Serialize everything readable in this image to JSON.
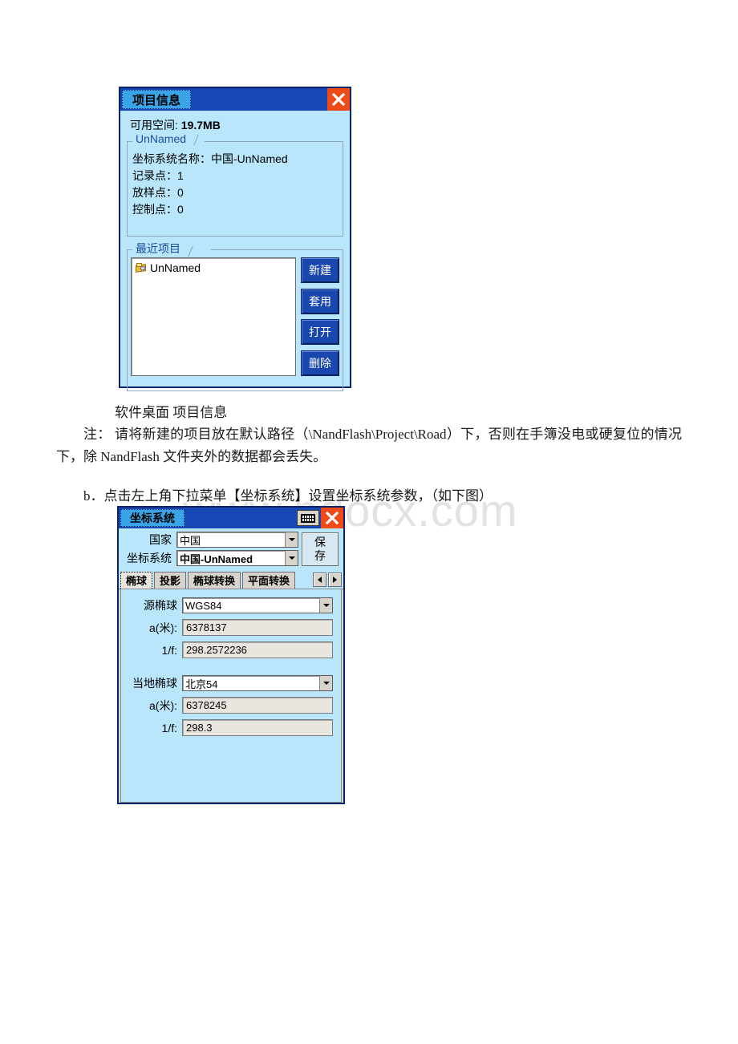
{
  "watermark": "www.bdocx.com",
  "project_dialog": {
    "title": "项目信息",
    "close_icon": "close-icon",
    "free_space_label": "可用空间:",
    "free_space_value": "19.7MB",
    "project_group": {
      "caption": "UnNamed",
      "lines": [
        "坐标系统名称：中国-UnNamed",
        "记录点：1",
        "放样点：0",
        "控制点：0"
      ]
    },
    "recent_group": {
      "caption": "最近项目",
      "items": [
        {
          "icon": "project-file-icon",
          "label": "UnNamed"
        }
      ],
      "buttons": [
        {
          "label": "新建"
        },
        {
          "label": "套用"
        },
        {
          "label": "打开"
        },
        {
          "label": "删除"
        }
      ]
    }
  },
  "doc": {
    "figure_caption": "软件桌面 项目信息",
    "note_paragraph": "注： 请将新建的项目放在默认路径（\\NandFlash\\Project\\Road）下，否则在手簿没电或硬复位的情况下，除 NandFlash 文件夹外的数据都会丢失。",
    "step_b_paragraph": "b．点击左上角下拉菜单【坐标系统】设置坐标系统参数，（如下图）"
  },
  "coord_dialog": {
    "title": "坐标系统",
    "sip_icon": "keyboard-icon",
    "close_icon": "close-icon",
    "country_label": "国家",
    "country_value": "中国",
    "system_label": "坐标系统",
    "system_value": "中国-UnNamed",
    "save_button_line1": "保",
    "save_button_line2": "存",
    "tabs": [
      {
        "label": "椭球",
        "active": true
      },
      {
        "label": "投影",
        "active": false
      },
      {
        "label": "椭球转换",
        "active": false
      },
      {
        "label": "平面转换",
        "active": false
      }
    ],
    "tab_prev_icon": "chevron-left-icon",
    "tab_next_icon": "chevron-right-icon",
    "ellipsoid_tab": {
      "source": {
        "label": "源椭球",
        "value": "WGS84",
        "a_label": "a(米):",
        "a_value": "6378137",
        "invf_label": "1/f:",
        "invf_value": "298.2572236"
      },
      "local": {
        "label": "当地椭球",
        "value": "北京54",
        "a_label": "a(米):",
        "a_value": "6378245",
        "invf_label": "1/f:",
        "invf_value": "298.3"
      }
    }
  },
  "colors": {
    "titlebar_blue": "#1747b4",
    "title_tab_blue": "#3aa4e8",
    "dialog_body": "#b9e6fa",
    "close_red": "#f04b16",
    "button_blue": "#1a47ad",
    "selection_blue": "#0a3fb0"
  }
}
